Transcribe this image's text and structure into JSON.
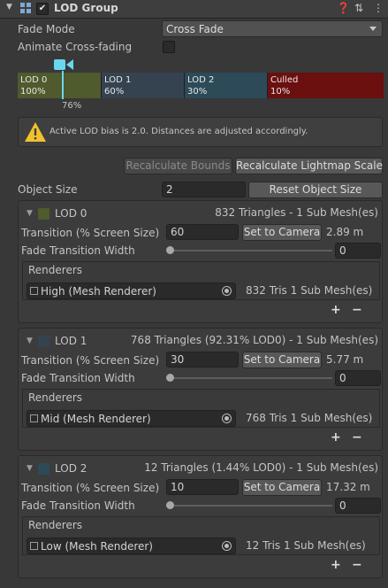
{
  "header": {
    "title": "LOD Group",
    "enabled": true
  },
  "fade_mode": {
    "label": "Fade Mode",
    "value": "Cross Fade"
  },
  "animate_cross_fading": {
    "label": "Animate Cross-fading"
  },
  "lod_bar": {
    "camera_percent": "76%",
    "segments": [
      {
        "name": "LOD 0",
        "percent": "100%",
        "color": "#4f5a2d"
      },
      {
        "name": "LOD 1",
        "percent": "60%",
        "color": "#354350"
      },
      {
        "name": "LOD 2",
        "percent": "30%",
        "color": "#2d4a58"
      },
      {
        "name": "Culled",
        "percent": "10%",
        "color": "#6b0f0f"
      }
    ]
  },
  "help_text": "Active LOD bias is 2.0. Distances are adjusted accordingly.",
  "buttons": {
    "recalc_bounds": "Recalculate Bounds",
    "recalc_lightmap": "Recalculate Lightmap Scale",
    "reset_object_size": "Reset Object Size"
  },
  "object_size": {
    "label": "Object Size",
    "value": "2"
  },
  "common": {
    "transition_label": "Transition (% Screen Size)",
    "fade_label": "Fade Transition Width",
    "renderers_label": "Renderers",
    "set_camera": "Set to Camera",
    "plus": "+",
    "minus": "−"
  },
  "lods": [
    {
      "name": "LOD 0",
      "info": "832 Triangles  - 1 Sub Mesh(es)",
      "transition": "60",
      "distance": "2.89 m",
      "fade": "0",
      "renderer": "High (Mesh Renderer)",
      "renderer_info": "832 Tris 1 Sub Mesh(es)",
      "color": "#4f5a2d",
      "fade_level": 0
    },
    {
      "name": "LOD 1",
      "info": "768 Triangles (92.31% LOD0) - 1 Sub Mesh(es)",
      "transition": "30",
      "distance": "5.77 m",
      "fade": "0",
      "renderer": "Mid (Mesh Renderer)",
      "renderer_info": "768 Tris 1 Sub Mesh(es)",
      "color": "#354350",
      "fade_level": 0
    },
    {
      "name": "LOD 2",
      "info": "12 Triangles (1.44% LOD0) - 1 Sub Mesh(es)",
      "transition": "10",
      "distance": "17.32 m",
      "fade": "0",
      "renderer": "Low (Mesh Renderer)",
      "renderer_info": "12 Tris 1 Sub Mesh(es)",
      "color": "#2d4a58",
      "fade_level": 0
    }
  ]
}
